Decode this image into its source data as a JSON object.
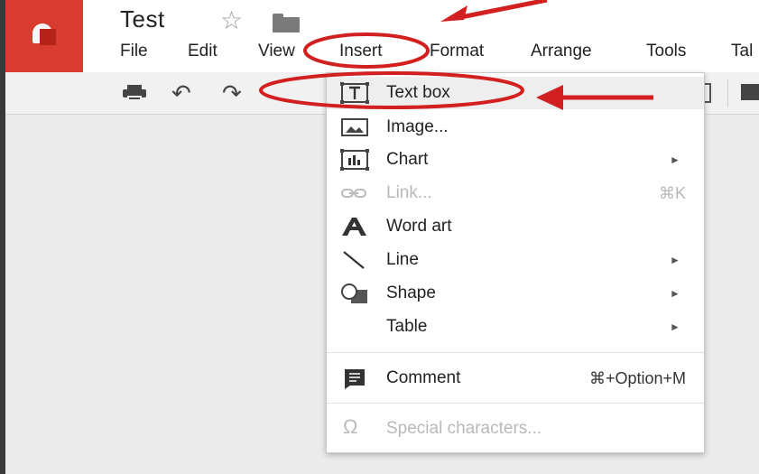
{
  "doc": {
    "title": "Test"
  },
  "icons": {
    "star": "☆",
    "undo": "↶",
    "redo": "↷",
    "submenu_arrow": "►",
    "omega": "Ω"
  },
  "colors": {
    "logo": "#d83b2f",
    "annotation": "#d21f1f",
    "highlight": "#eeeeee"
  },
  "menubar": {
    "file": "File",
    "edit": "Edit",
    "view": "View",
    "insert": "Insert",
    "format": "Format",
    "arrange": "Arrange",
    "tools": "Tools",
    "table": "Tal"
  },
  "insert_menu": {
    "text_box": "Text box",
    "image": "Image...",
    "chart": "Chart",
    "link": "Link...",
    "link_shortcut": "⌘K",
    "word_art": "Word art",
    "line": "Line",
    "shape": "Shape",
    "table": "Table",
    "comment": "Comment",
    "comment_shortcut": "⌘+Option+M",
    "special_characters": "Special characters..."
  }
}
